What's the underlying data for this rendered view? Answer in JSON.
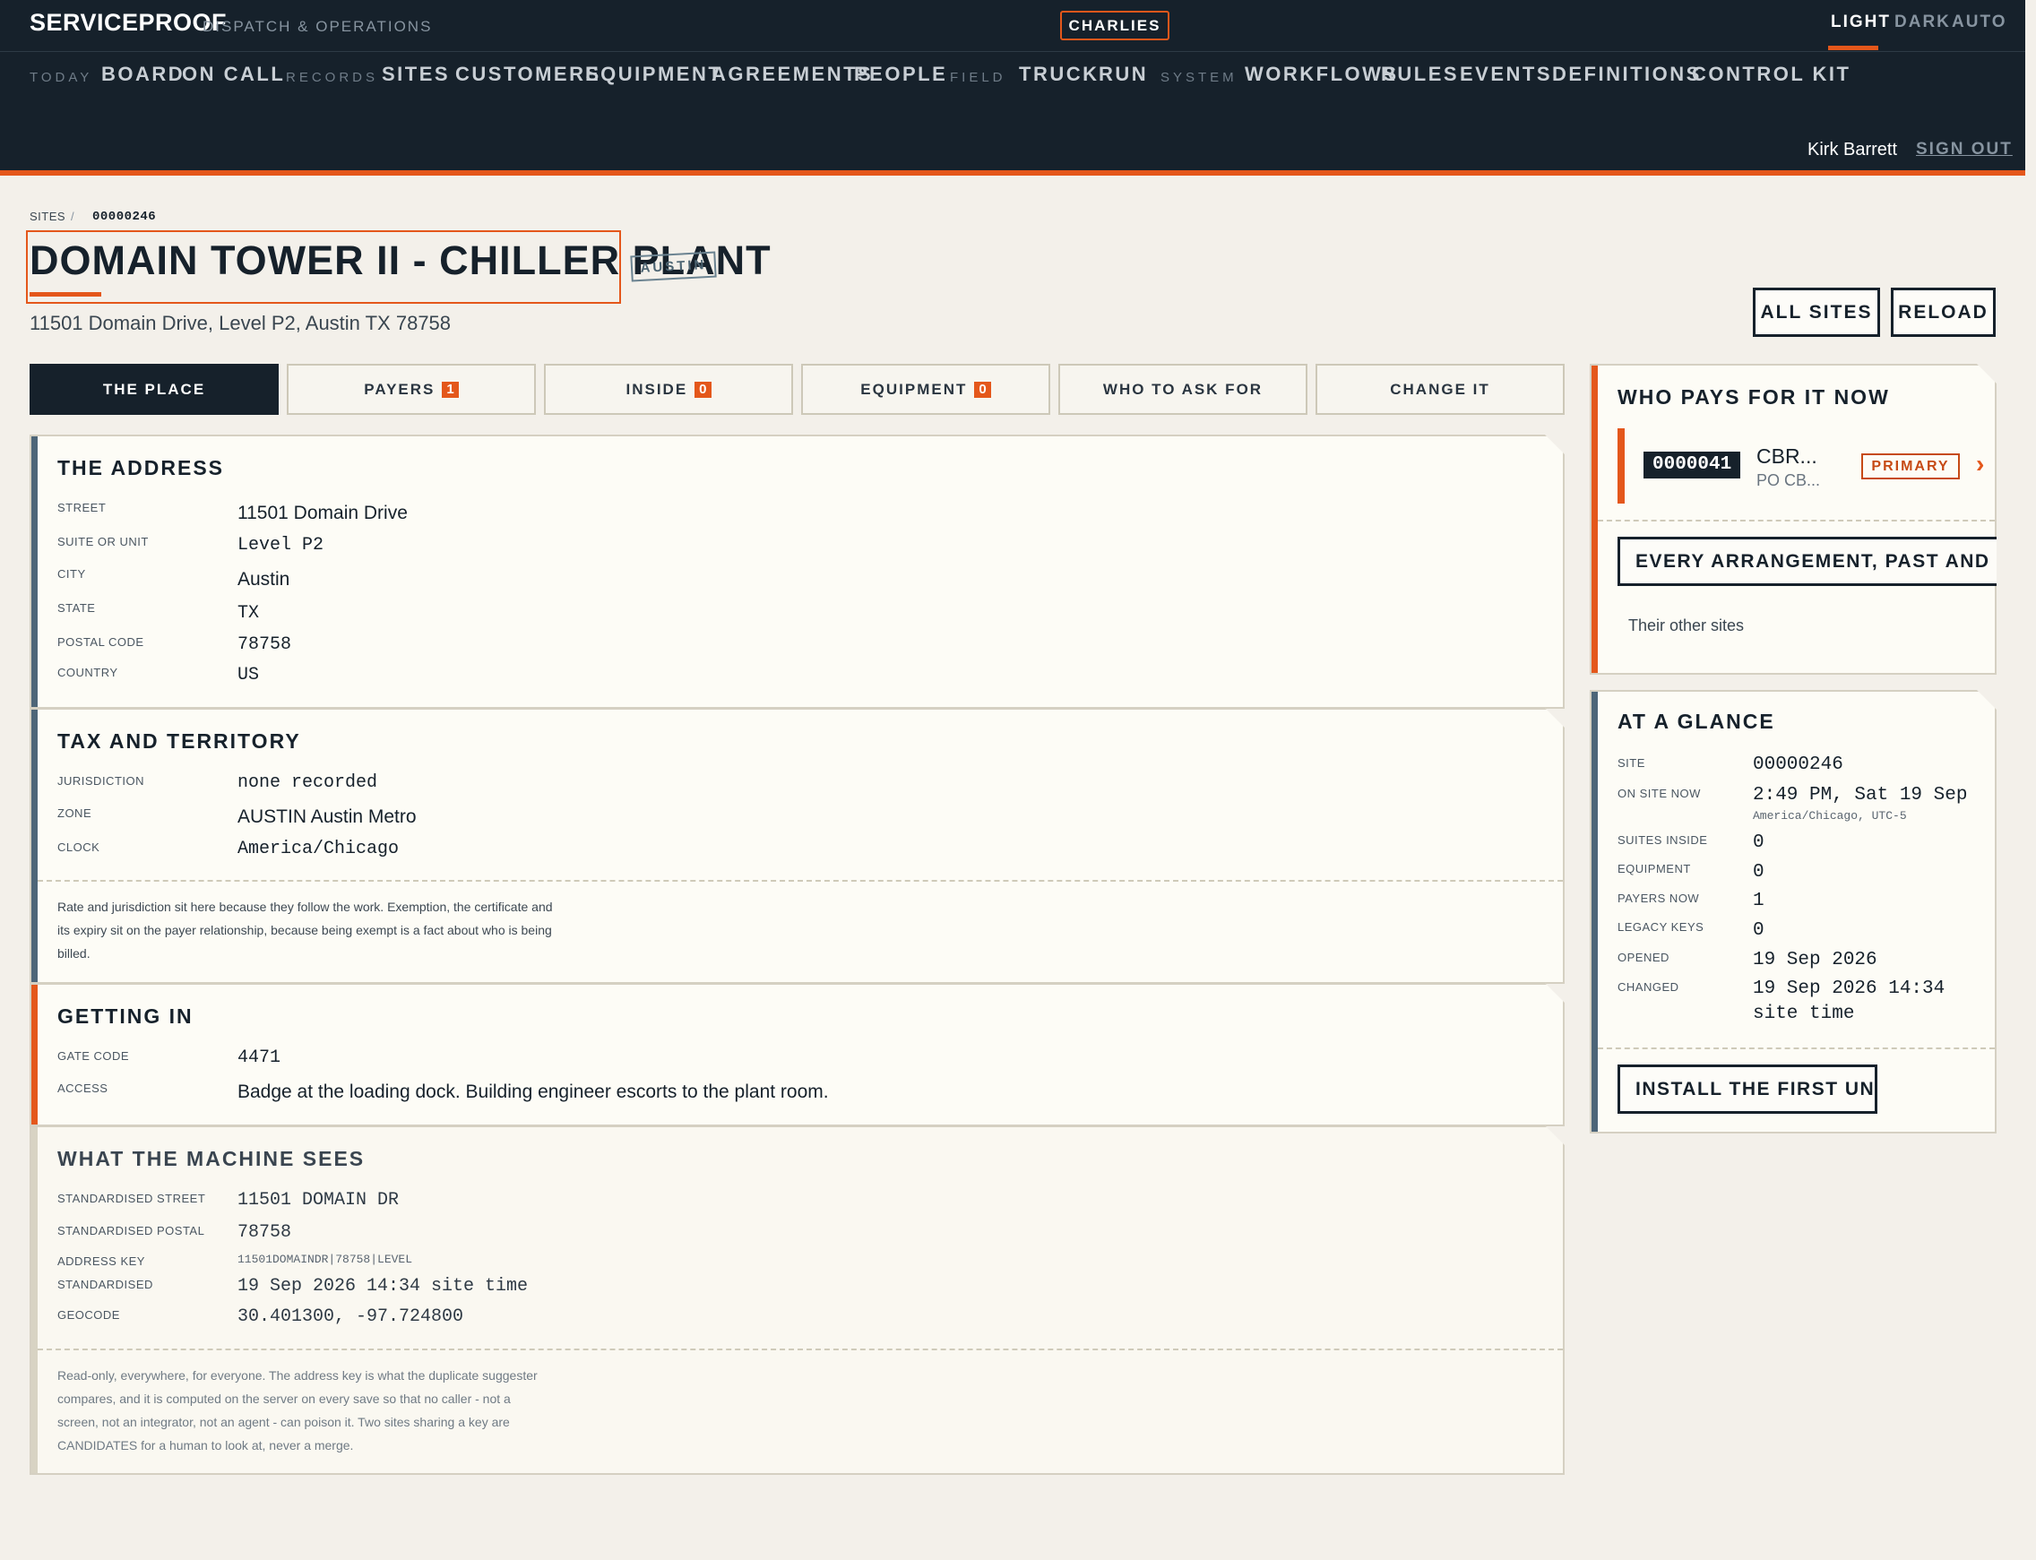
{
  "header": {
    "brand": "SERVICEPROOF",
    "brand_sub": "DISPATCH & OPERATIONS",
    "tenant": "CHARLIES",
    "theme": [
      "LIGHT",
      "DARK",
      "AUTO"
    ],
    "nav": {
      "groups": [
        "TODAY",
        "RECORDS",
        "FIELD",
        "SYSTEM"
      ],
      "items": [
        "BOARD",
        "ON CALL",
        "SITES",
        "CUSTOMERS",
        "EQUIPMENT",
        "AGREEMENTS",
        "PEOPLE",
        "TRUCK",
        "RUN",
        "WORKFLOWS",
        "RULES",
        "EVENTS",
        "DEFINITIONS",
        "CONTROL KIT"
      ]
    },
    "user": "Kirk Barrett",
    "sign_out": "SIGN OUT"
  },
  "breadcrumb": {
    "root": "SITES",
    "sep": "/",
    "current": "00000246"
  },
  "page": {
    "title": "DOMAIN TOWER II - CHILLER PLANT",
    "city_tag": "AUSTIN",
    "address": "11501 Domain Drive, Level P2, Austin TX 78758",
    "buttons": {
      "all_sites": "ALL SITES",
      "reload": "RELOAD"
    }
  },
  "tabs": [
    {
      "label": "THE PLACE",
      "count": null,
      "active": true
    },
    {
      "label": "PAYERS",
      "count": "1",
      "active": false
    },
    {
      "label": "INSIDE",
      "count": "0",
      "active": false
    },
    {
      "label": "EQUIPMENT",
      "count": "0",
      "active": false
    },
    {
      "label": "WHO TO ASK FOR",
      "count": null,
      "active": false
    },
    {
      "label": "CHANGE IT",
      "count": null,
      "active": false
    }
  ],
  "address_section": {
    "title": "THE ADDRESS",
    "rows": [
      {
        "label": "STREET",
        "value": "11501 Domain Drive"
      },
      {
        "label": "SUITE OR UNIT",
        "value": "Level P2"
      },
      {
        "label": "CITY",
        "value": "Austin"
      },
      {
        "label": "STATE",
        "value": "TX"
      },
      {
        "label": "POSTAL CODE",
        "value": "78758"
      },
      {
        "label": "COUNTRY",
        "value": "US"
      }
    ]
  },
  "tax_section": {
    "title": "TAX AND TERRITORY",
    "rows": [
      {
        "label": "JURISDICTION",
        "value": "none recorded"
      },
      {
        "label": "ZONE",
        "value": "AUSTIN Austin Metro"
      },
      {
        "label": "CLOCK",
        "value": "America/Chicago"
      }
    ],
    "note": "Rate and jurisdiction sit here because they follow the work. Exemption, the certificate and its expiry sit on the payer relationship, because being exempt is a fact about who is being billed."
  },
  "access_section": {
    "title": "GETTING IN",
    "rows": [
      {
        "label": "GATE CODE",
        "value": "4471"
      },
      {
        "label": "ACCESS",
        "value": "Badge at the loading dock. Building engineer escorts to the plant room."
      }
    ]
  },
  "machine_section": {
    "title": "WHAT THE MACHINE SEES",
    "rows": [
      {
        "label": "STANDARDISED STREET",
        "value": "11501 DOMAIN DR"
      },
      {
        "label": "STANDARDISED POSTAL",
        "value": "78758"
      },
      {
        "label": "ADDRESS KEY",
        "value": "11501DOMAINDR|78758|LEVEL"
      },
      {
        "label": "STANDARDISED",
        "value": "19 Sep 2026 14:34 site time"
      },
      {
        "label": "GEOCODE",
        "value": "30.401300, -97.724800"
      }
    ],
    "note": "Read-only, everywhere, for everyone. The address key is what the duplicate suggester compares, and it is computed on the server on every save so that no caller - not a screen, not an integrator, not an agent - can poison it. Two sites sharing a key are CANDIDATES for a human to look at, never a merge."
  },
  "payer_panel": {
    "title": "WHO PAYS FOR IT NOW",
    "payer_id": "0000041",
    "payer_name": "CBR...",
    "payer_addr": "PO CB...",
    "primary": "PRIMARY",
    "chevron": "›",
    "arrangements_button": "EVERY ARRANGEMENT, PAST AND PRESENT",
    "other_sites": "Their other sites"
  },
  "glance_panel": {
    "title": "AT A GLANCE",
    "rows": [
      {
        "label": "SITE",
        "value": "00000246"
      },
      {
        "label": "ON SITE NOW",
        "value": "2:49 PM, Sat 19 Sep",
        "sub": "America/Chicago, UTC-5"
      },
      {
        "label": "SUITES INSIDE",
        "value": "0"
      },
      {
        "label": "EQUIPMENT",
        "value": "0"
      },
      {
        "label": "PAYERS NOW",
        "value": "1"
      },
      {
        "label": "LEGACY KEYS",
        "value": "0"
      },
      {
        "label": "OPENED",
        "value": "19 Sep 2026"
      },
      {
        "label": "CHANGED",
        "value": "19 Sep 2026 14:34",
        "sub2": "site time"
      }
    ],
    "install_button": "INSTALL THE FIRST UNIT"
  },
  "colors": {
    "navy": "#16212b",
    "accent": "#e4571b",
    "slate_bar": "#4d6578",
    "paper": "#f3f0ea",
    "card": "#fdfcf6"
  }
}
